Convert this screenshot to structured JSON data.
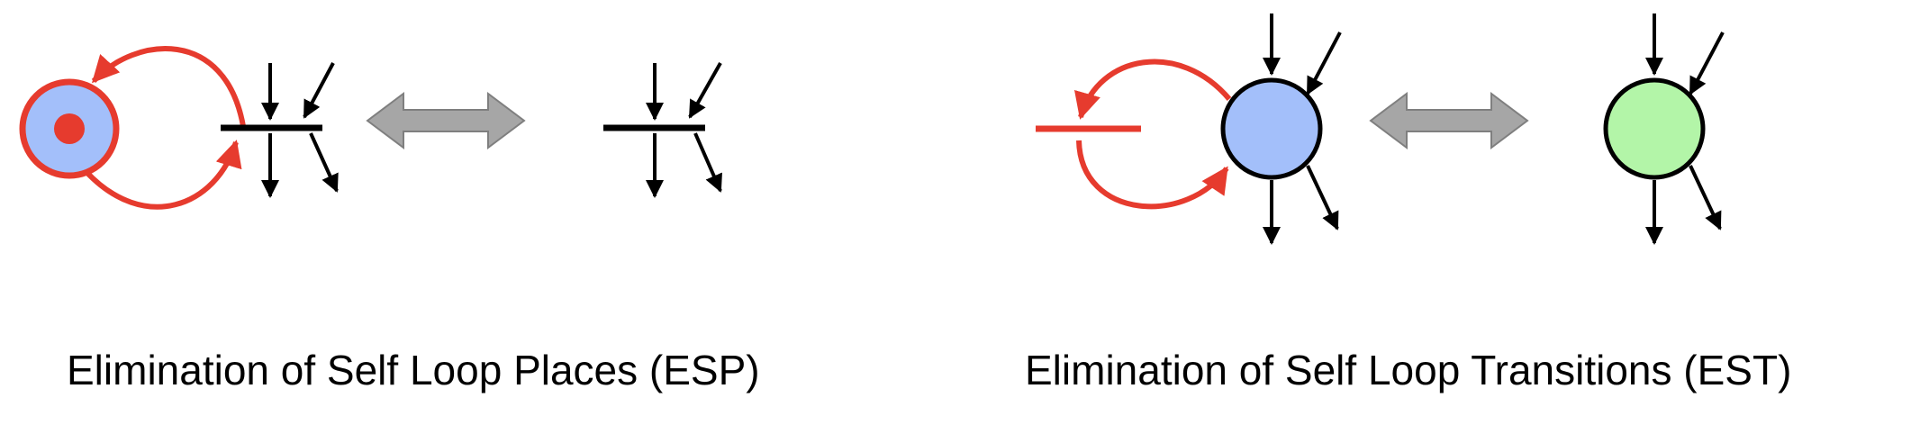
{
  "colors": {
    "red": "#e63b2e",
    "black": "#000000",
    "place_blue": "#a3bffa",
    "place_green": "#b3f5a8",
    "equivalence_arrow_fill": "#a6a6a6",
    "equivalence_arrow_stroke": "#7f7f7f"
  },
  "panels": [
    {
      "id": "esp",
      "caption": "Elimination of Self Loop Places (ESP)"
    },
    {
      "id": "est",
      "caption": "Elimination of Self Loop Transitions (EST)"
    }
  ]
}
